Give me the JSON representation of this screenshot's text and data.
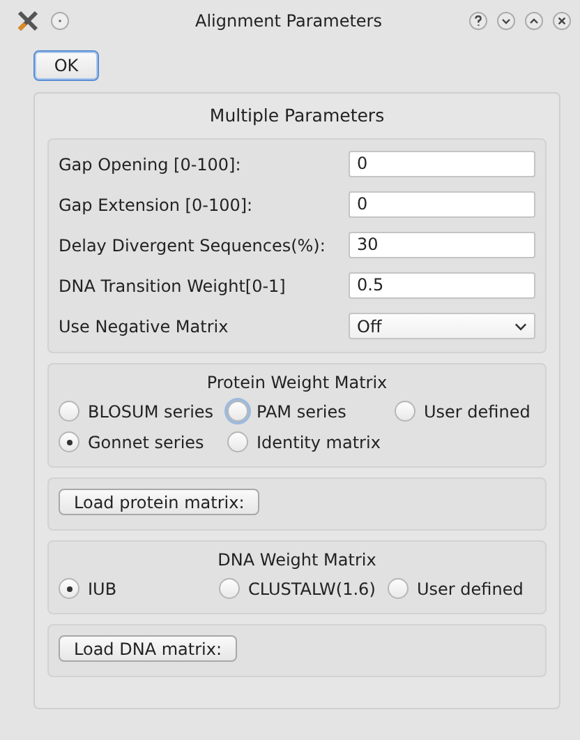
{
  "window": {
    "title": "Alignment Parameters"
  },
  "ok_button": "OK",
  "multiple_parameters": {
    "title": "Multiple Parameters",
    "fields": [
      {
        "kind": "text",
        "label": "Gap Opening [0-100]:",
        "value": "0"
      },
      {
        "kind": "text",
        "label": "Gap Extension [0-100]:",
        "value": "0"
      },
      {
        "kind": "text",
        "label": "Delay Divergent Sequences(%):",
        "value": "30"
      },
      {
        "kind": "text",
        "label": "DNA Transition Weight[0-1]",
        "value": "0.5"
      },
      {
        "kind": "select",
        "label": "Use Negative Matrix",
        "value": "Off"
      }
    ]
  },
  "protein_weight_matrix": {
    "title": "Protein Weight Matrix",
    "options": [
      {
        "label": "BLOSUM series",
        "selected": false,
        "focused": false
      },
      {
        "label": "PAM series",
        "selected": false,
        "focused": true
      },
      {
        "label": "User defined",
        "selected": false,
        "focused": false
      },
      {
        "label": "Gonnet series",
        "selected": true,
        "focused": false
      },
      {
        "label": "Identity matrix",
        "selected": false,
        "focused": false
      }
    ]
  },
  "load_protein_button": "Load protein matrix:",
  "dna_weight_matrix": {
    "title": "DNA Weight Matrix",
    "options": [
      {
        "label": "IUB",
        "selected": true
      },
      {
        "label": "CLUSTALW(1.6)",
        "selected": false
      },
      {
        "label": "User defined",
        "selected": false
      }
    ]
  },
  "load_dna_button": "Load DNA matrix:"
}
